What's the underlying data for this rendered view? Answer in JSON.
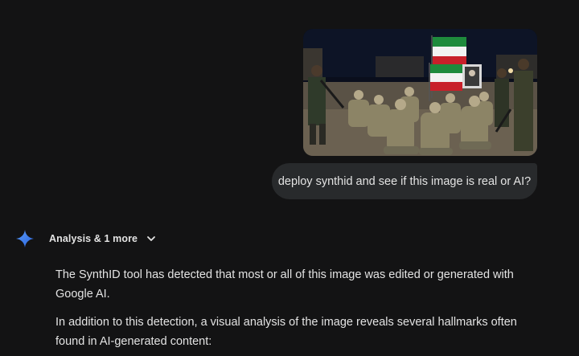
{
  "conversation": {
    "user_message": {
      "image_alt": "Photo of soldiers kneeling at night with Iranian flags and a portrait in the background",
      "text": "deploy synthid and see if this image is real or AI?"
    },
    "model_response": {
      "tools_label": "Analysis & 1 more",
      "paragraphs": [
        "The SynthID tool has detected that most or all of this image was edited or generated with Google AI.",
        "In addition to this detection, a visual analysis of the image reveals several hallmarks often found in AI-generated content:"
      ]
    }
  },
  "icons": {
    "assistant_logo": "gemini-sparkle-icon",
    "expand": "chevron-down-icon"
  },
  "colors": {
    "background": "#131314",
    "user_bubble": "#282a2c",
    "text": "#e3e3e3",
    "sparkle_start": "#4f8df5",
    "sparkle_end": "#2e6be6"
  }
}
